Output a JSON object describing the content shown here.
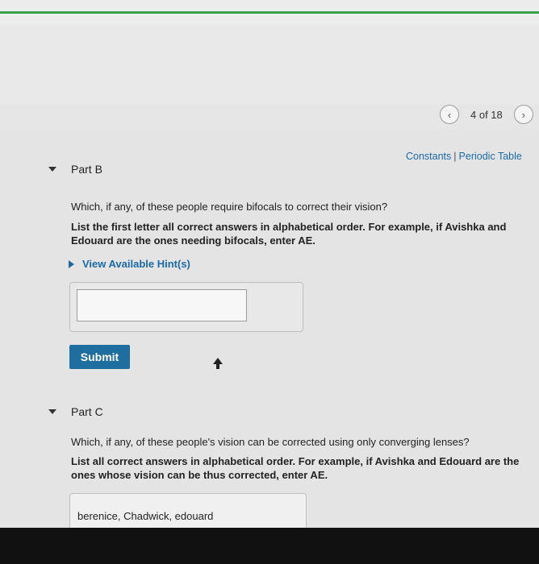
{
  "pager": {
    "prev_icon": "chevron-left-icon",
    "count": "4 of 18",
    "next_icon": "chevron-right-icon"
  },
  "links": {
    "constants": "Constants",
    "separator": "|",
    "periodic_table": "Periodic Table"
  },
  "part_b": {
    "title": "Part B",
    "question": "Which, if any, of these people require bifocals to correct their vision?",
    "instruction": "List the first letter all correct answers in alphabetical order. For example, if Avishka and Edouard are the ones needing bifocals, enter AE.",
    "hint_label": "View Available Hint(s)",
    "answer_value": "",
    "submit_label": "Submit"
  },
  "part_c": {
    "title": "Part C",
    "question": "Which, if any, of these people's vision can be corrected using only converging lenses?",
    "instruction": "List all correct answers in alphabetical order. For example, if Avishka and Edouard are the ones whose vision can be thus corrected, enter AE.",
    "answer_value": "berenice, Chadwick, edouard"
  },
  "colors": {
    "link": "#1a6aa8",
    "submit_bg": "#1e6f9f",
    "top_line": "#3aa14a"
  }
}
